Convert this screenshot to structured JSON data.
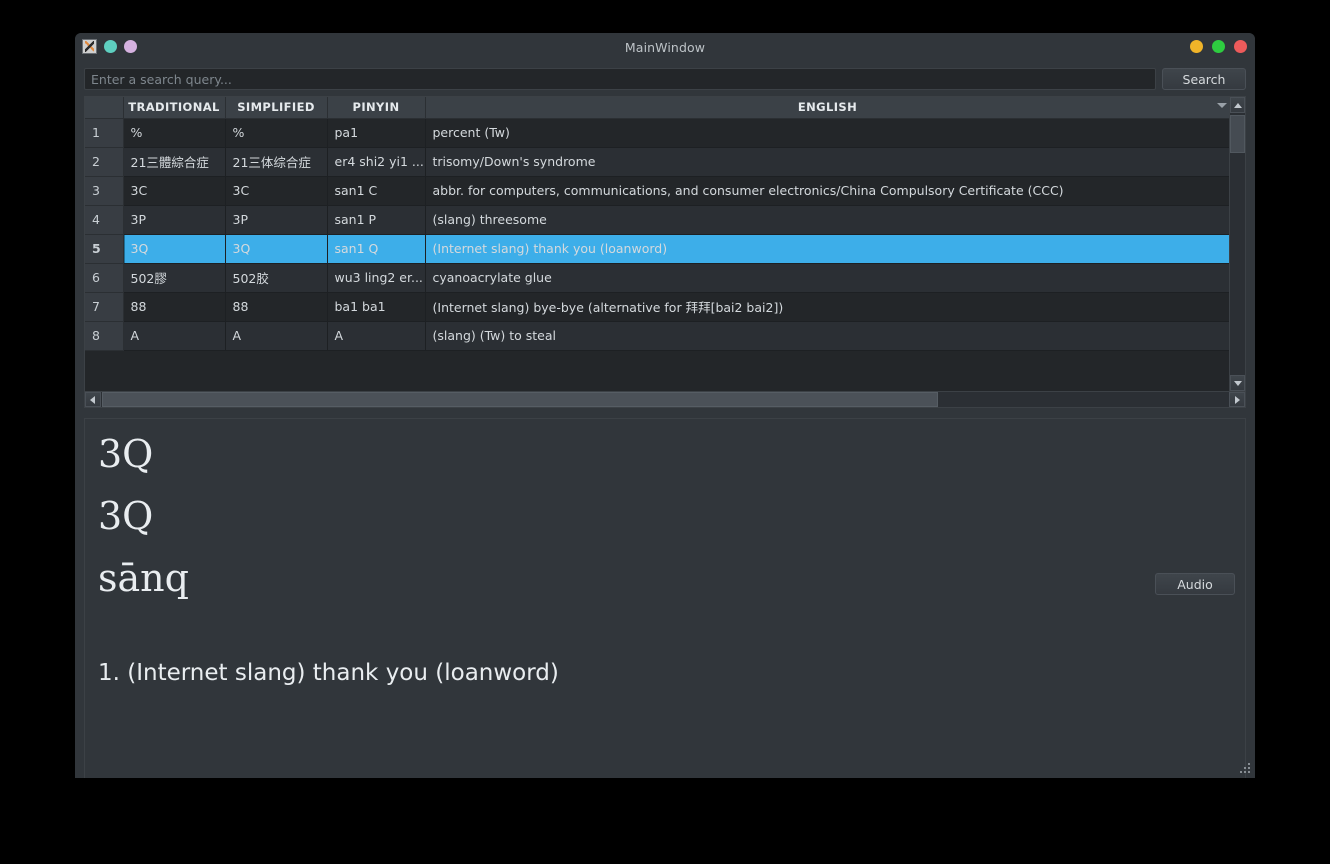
{
  "window": {
    "title": "MainWindow",
    "app_icon": "app-icon",
    "left_controls": [
      {
        "name": "app-icon",
        "color": "#cfcfcf"
      },
      {
        "name": "titlebar-dot-teal",
        "color": "#5ecfc0"
      },
      {
        "name": "titlebar-dot-purple",
        "color": "#d5b2e0"
      }
    ],
    "right_controls": [
      {
        "name": "minimize-button",
        "color": "#f0b429"
      },
      {
        "name": "maximize-button",
        "color": "#2ecc40"
      },
      {
        "name": "close-button",
        "color": "#ed5b5b"
      }
    ]
  },
  "search": {
    "placeholder": "Enter a search query...",
    "value": "",
    "button_label": "Search"
  },
  "table": {
    "headers": [
      "",
      "TRADITIONAL",
      "SIMPLIFIED",
      "PINYIN",
      "ENGLISH"
    ],
    "selected_row": 5,
    "rows": [
      {
        "num": "1",
        "traditional": "%",
        "simplified": "%",
        "pinyin": "pa1",
        "english": "percent (Tw)"
      },
      {
        "num": "2",
        "traditional": "21三體綜合症",
        "simplified": "21三体综合症",
        "pinyin": "er4 shi2 yi1 ...",
        "english": "trisomy/Down's syndrome"
      },
      {
        "num": "3",
        "traditional": "3C",
        "simplified": "3C",
        "pinyin": "san1 C",
        "english": "abbr. for computers, communications, and consumer electronics/China Compulsory Certificate (CCC)"
      },
      {
        "num": "4",
        "traditional": "3P",
        "simplified": "3P",
        "pinyin": "san1 P",
        "english": "(slang) threesome"
      },
      {
        "num": "5",
        "traditional": "3Q",
        "simplified": "3Q",
        "pinyin": "san1 Q",
        "english": "(Internet slang) thank you (loanword)"
      },
      {
        "num": "6",
        "traditional": "502膠",
        "simplified": "502胶",
        "pinyin": "wu3 ling2 er...",
        "english": "cyanoacrylate glue"
      },
      {
        "num": "7",
        "traditional": "88",
        "simplified": "88",
        "pinyin": "ba1 ba1",
        "english": "(Internet slang) bye-bye (alternative for 拜拜[bai2 bai2])"
      },
      {
        "num": "8",
        "traditional": "A",
        "simplified": "A",
        "pinyin": "A",
        "english": "(slang) (Tw) to steal"
      }
    ]
  },
  "detail": {
    "traditional": "3Q",
    "simplified": "3Q",
    "pinyin": "sānq",
    "audio_label": "Audio",
    "definitions": [
      "1. (Internet slang) thank you (loanword)"
    ]
  },
  "colors": {
    "accent": "#3daee9",
    "window_bg": "#31363b",
    "row_odd": "#232629",
    "row_even": "#2b2f34",
    "header_bg": "#3b4147"
  }
}
